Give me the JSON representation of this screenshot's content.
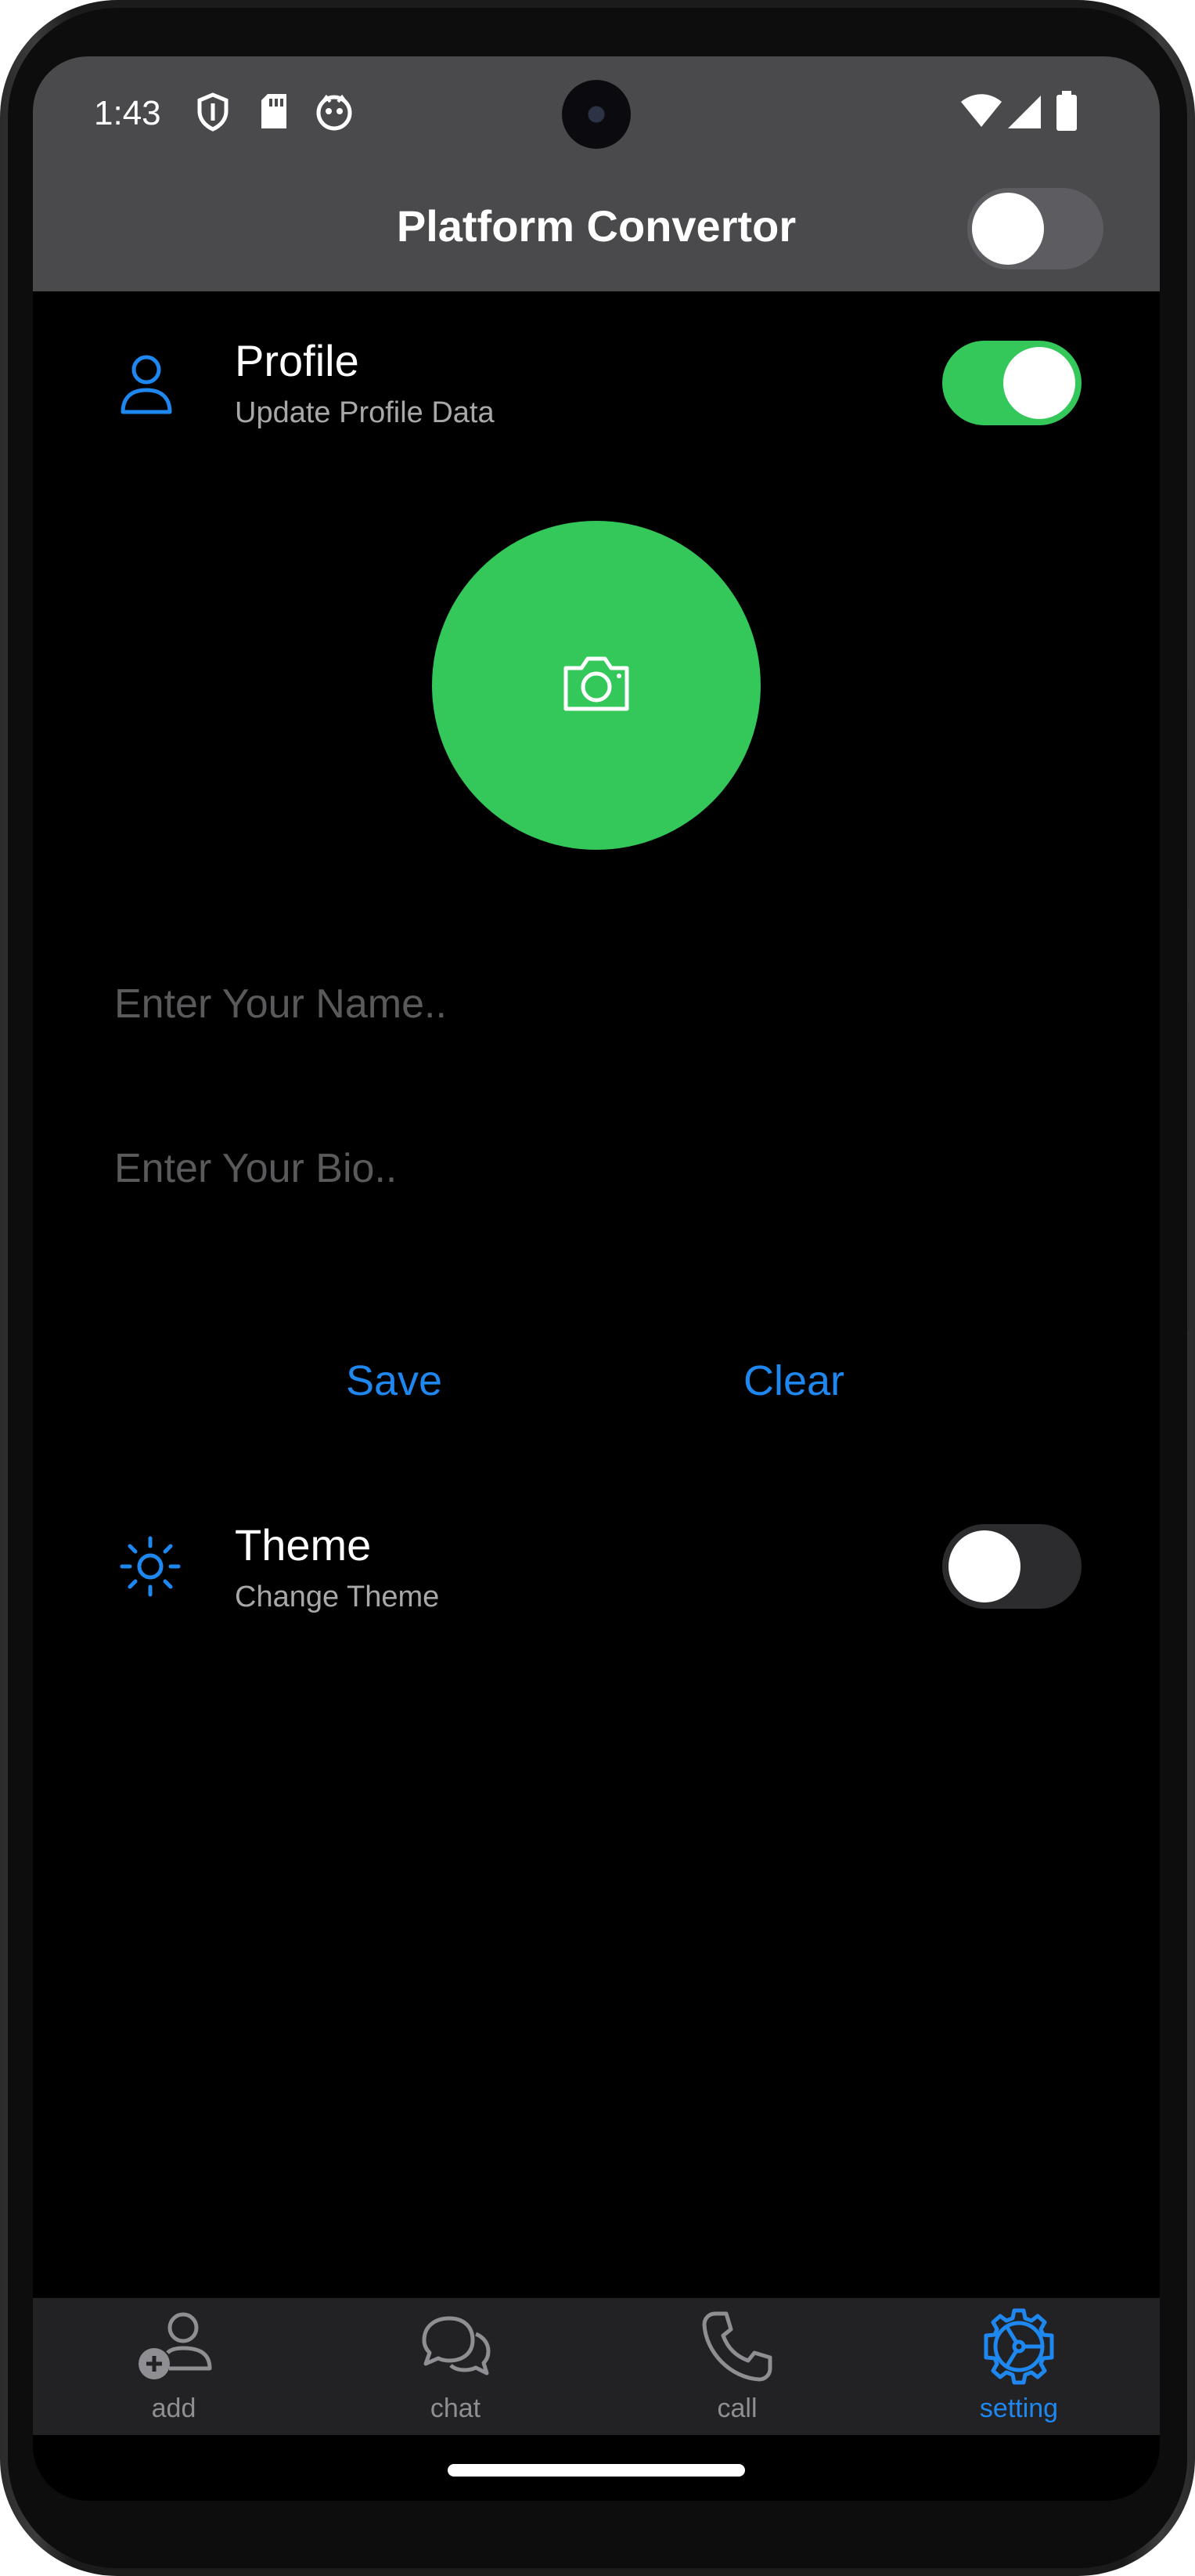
{
  "status_bar": {
    "time": "1:43",
    "left_icons": [
      "shield-icon",
      "sd-card-icon",
      "app-notification-icon"
    ],
    "right_icons": [
      "wifi-icon",
      "cellular-signal-icon",
      "battery-icon"
    ]
  },
  "app_bar": {
    "title": "Platform Convertor",
    "platform_toggle_on": false
  },
  "profile": {
    "icon": "person-icon",
    "title": "Profile",
    "subtitle": "Update Profile Data",
    "toggle_on": true,
    "avatar_icon": "camera-icon",
    "avatar_color": "#34C759",
    "name_input": {
      "value": "",
      "placeholder": "Enter Your Name.."
    },
    "bio_input": {
      "value": "",
      "placeholder": "Enter Your Bio.."
    },
    "save_label": "Save",
    "clear_label": "Clear"
  },
  "theme": {
    "icon": "sun-icon",
    "title": "Theme",
    "subtitle": "Change Theme",
    "toggle_on": false
  },
  "bottom_nav": {
    "items": [
      {
        "label": "add",
        "icon": "add-person-icon",
        "active": false
      },
      {
        "label": "chat",
        "icon": "chat-bubbles-icon",
        "active": false
      },
      {
        "label": "call",
        "icon": "phone-icon",
        "active": false
      },
      {
        "label": "setting",
        "icon": "settings-gear-icon",
        "active": true
      }
    ]
  },
  "colors": {
    "accent_blue": "#1E88F0",
    "toggle_green": "#34C759",
    "app_bar": "#4A4A4C",
    "background": "#000000",
    "nav_background": "#222224"
  }
}
